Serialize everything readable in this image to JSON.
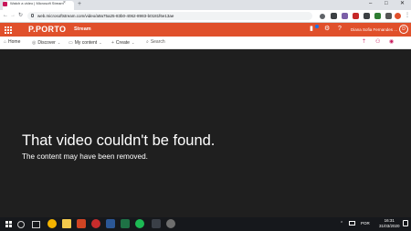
{
  "browser": {
    "tab_title": "Watch a video | Microsoft Stream",
    "tab_close": "×",
    "new_tab": "+",
    "url": "web.microsoftstream.com/video/a9a75a25-83b0-4062-8983-b0181f6e13ae",
    "minimize": "–",
    "maximize": "□",
    "close": "✕",
    "back": "←",
    "forward": "→",
    "reload": "↻",
    "menu": "⋮"
  },
  "header": {
    "logo": "P.PORTO",
    "app_name": "Stream",
    "help": "?",
    "settings": "⚙",
    "user_name": "Diana Sofia Fernandes ...",
    "avatar": "D"
  },
  "subnav": {
    "home": "Home",
    "discover": "Discover",
    "my_content": "My content",
    "create": "Create",
    "search_placeholder": "Search"
  },
  "error": {
    "title": "That video couldn't be found.",
    "subtitle": "The content may have been removed."
  },
  "taskbar": {
    "lang": "POR",
    "time": "16:31",
    "date": "31/03/2020"
  },
  "colors": {
    "brand": "#e0502b",
    "accent": "#c8175a"
  }
}
